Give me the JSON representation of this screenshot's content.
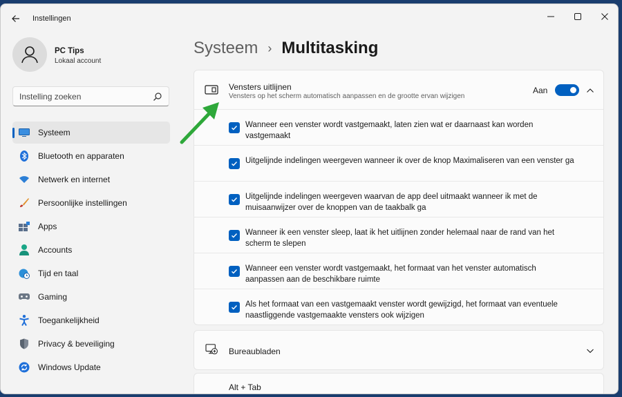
{
  "window": {
    "title": "Instellingen",
    "back_icon": "back-arrow-icon",
    "controls": [
      "minimize-icon",
      "maximize-icon",
      "close-icon"
    ]
  },
  "profile": {
    "name": "PC Tips",
    "account_type": "Lokaal account"
  },
  "search": {
    "placeholder": "Instelling zoeken"
  },
  "sidebar": {
    "items": [
      {
        "label": "Systeem",
        "icon": "monitor-icon",
        "active": true
      },
      {
        "label": "Bluetooth en apparaten",
        "icon": "bluetooth-icon"
      },
      {
        "label": "Netwerk en internet",
        "icon": "wifi-icon"
      },
      {
        "label": "Persoonlijke instellingen",
        "icon": "brush-icon"
      },
      {
        "label": "Apps",
        "icon": "apps-icon"
      },
      {
        "label": "Accounts",
        "icon": "person-icon"
      },
      {
        "label": "Tijd en taal",
        "icon": "clock-globe-icon"
      },
      {
        "label": "Gaming",
        "icon": "gamepad-icon"
      },
      {
        "label": "Toegankelijkheid",
        "icon": "accessibility-icon"
      },
      {
        "label": "Privacy & beveiliging",
        "icon": "shield-icon"
      },
      {
        "label": "Windows Update",
        "icon": "update-icon"
      }
    ]
  },
  "breadcrumb": {
    "parent": "Systeem",
    "separator": "›",
    "current": "Multitasking"
  },
  "snap": {
    "title": "Vensters uitlijnen",
    "description": "Vensters op het scherm automatisch aanpassen en de grootte ervan wijzigen",
    "toggle_label": "Aan",
    "enabled": true,
    "options": [
      {
        "text": "Wanneer een venster wordt vastgemaakt, laten zien wat er daarnaast kan worden vastgemaakt",
        "checked": true
      },
      {
        "text": "Uitgelijnde indelingen weergeven wanneer ik over de knop Maximaliseren van een venster ga",
        "checked": true
      },
      {
        "text": "Uitgelijnde indelingen weergeven waarvan de app deel uitmaakt wanneer ik met de muisaanwijzer over de knoppen van de taakbalk ga",
        "checked": true
      },
      {
        "text": "Wanneer ik een venster sleep, laat ik het uitlijnen zonder helemaal naar de rand van het scherm te slepen",
        "checked": true
      },
      {
        "text": "Wanneer een venster wordt vastgemaakt, het formaat van het venster automatisch aanpassen aan de beschikbare ruimte",
        "checked": true
      },
      {
        "text": "Als het formaat van een vastgemaakt venster wordt gewijzigd, het formaat van eventuele naastliggende vastgemaakte vensters ook wijzigen",
        "checked": true
      }
    ]
  },
  "desktops": {
    "title": "Bureaubladen",
    "icon": "virtual-desktop-icon"
  },
  "alt_tab": {
    "title": "Alt + Tab"
  },
  "colors": {
    "accent": "#0060c0",
    "annotation_arrow": "#2ea83a"
  }
}
